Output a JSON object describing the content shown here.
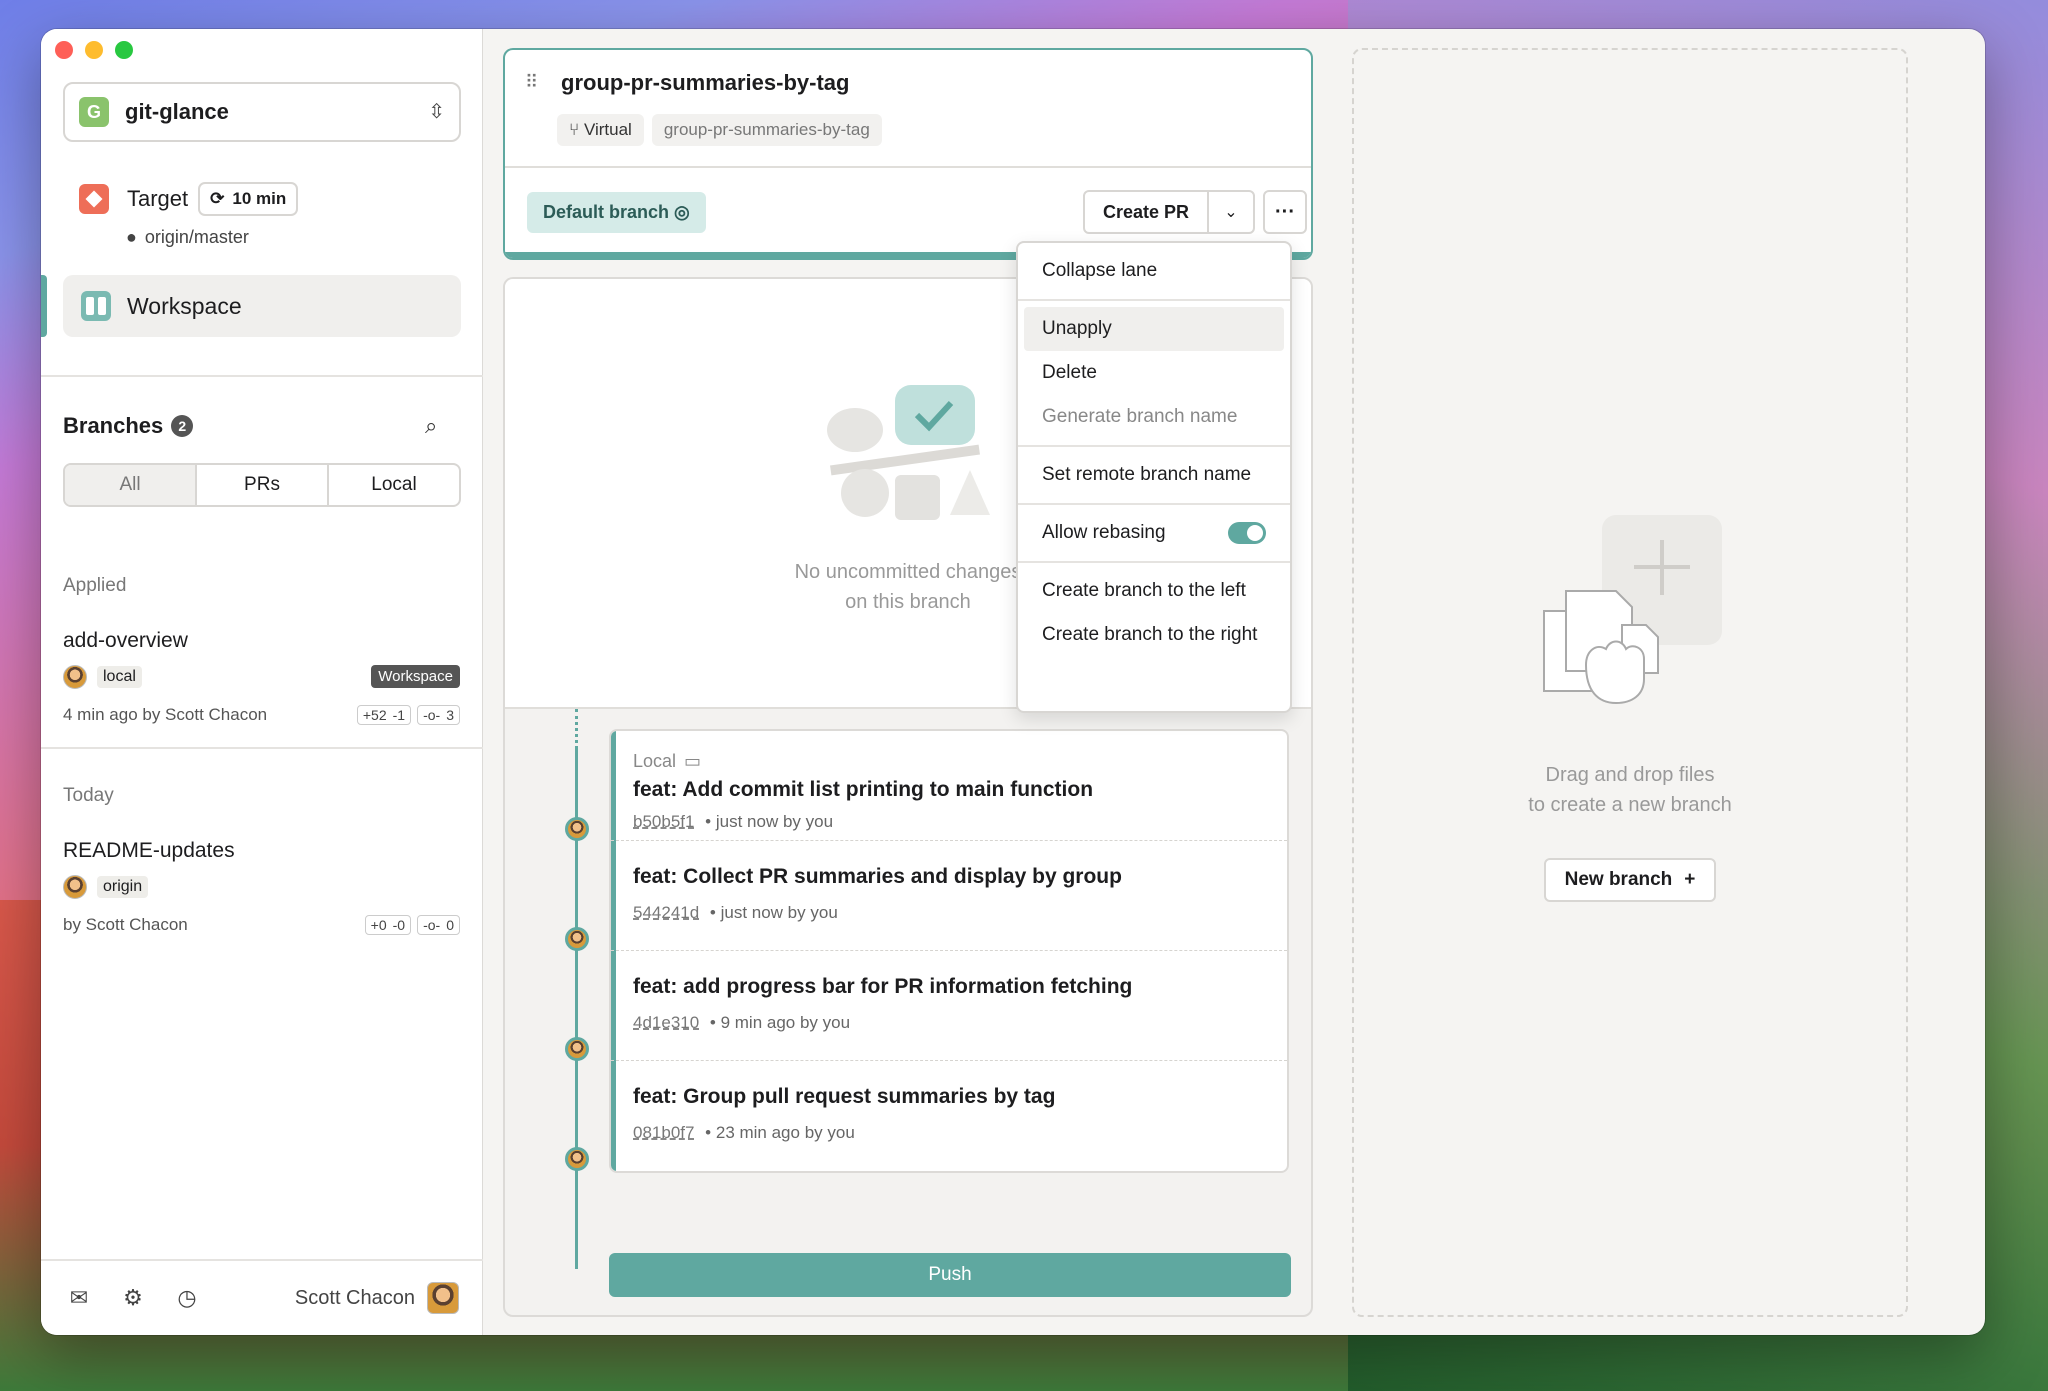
{
  "sidebar": {
    "project": {
      "logo_letter": "G",
      "name": "git-glance"
    },
    "target": {
      "label": "Target",
      "badge": "10 min",
      "remote": "origin/master"
    },
    "workspace": {
      "label": "Workspace"
    },
    "branches": {
      "title": "Branches",
      "count": "2",
      "tabs": [
        "All",
        "PRs",
        "Local"
      ],
      "groups": [
        {
          "label": "Applied",
          "branch": {
            "name": "add-overview",
            "tag": "local",
            "workspace_tag": "Workspace",
            "when": "4 min ago by Scott Chacon",
            "additions": "+52",
            "deletions": "-1",
            "commits": "3"
          }
        },
        {
          "label": "Today",
          "branch": {
            "name": "README-updates",
            "tag": "origin",
            "when": "by Scott Chacon",
            "additions": "+0",
            "deletions": "-0",
            "commits": "0"
          }
        }
      ]
    },
    "footer": {
      "icons": [
        "mail-icon",
        "settings-icon",
        "history-icon"
      ],
      "user": "Scott Chacon"
    }
  },
  "lane": {
    "title": "group-pr-summaries-by-tag",
    "tags": {
      "virtual": "Virtual",
      "name": "group-pr-summaries-by-tag"
    },
    "default_branch": "Default branch",
    "create_pr": "Create PR",
    "empty_text_1": "No uncommitted changes",
    "empty_text_2": "on this branch",
    "local_label": "Local",
    "commits": [
      {
        "title": "feat: Add commit list printing to main function",
        "hash": "b50b5f1",
        "when": "just now by you"
      },
      {
        "title": "feat: Collect PR summaries and display by group",
        "hash": "544241d",
        "when": "just now by you"
      },
      {
        "title": "feat: add progress bar for PR information fetching",
        "hash": "4d1e310",
        "when": "9 min ago by you"
      },
      {
        "title": "feat: Group pull request summaries by tag",
        "hash": "081b0f7",
        "when": "23 min ago by you"
      }
    ],
    "push": "Push"
  },
  "menu": {
    "collapse": "Collapse lane",
    "unapply": "Unapply",
    "delete": "Delete",
    "generate_name": "Generate branch name",
    "set_remote": "Set remote branch name",
    "allow_rebasing": "Allow rebasing",
    "allow_rebasing_on": true,
    "create_left": "Create branch to the left",
    "create_right": "Create branch to the right"
  },
  "dropzone": {
    "text_1": "Drag and drop files",
    "text_2": "to create a new branch",
    "new_branch": "New branch"
  },
  "colors": {
    "accent": "#5fa8a0",
    "target": "#ee6e58",
    "project": "#8ac36c"
  }
}
